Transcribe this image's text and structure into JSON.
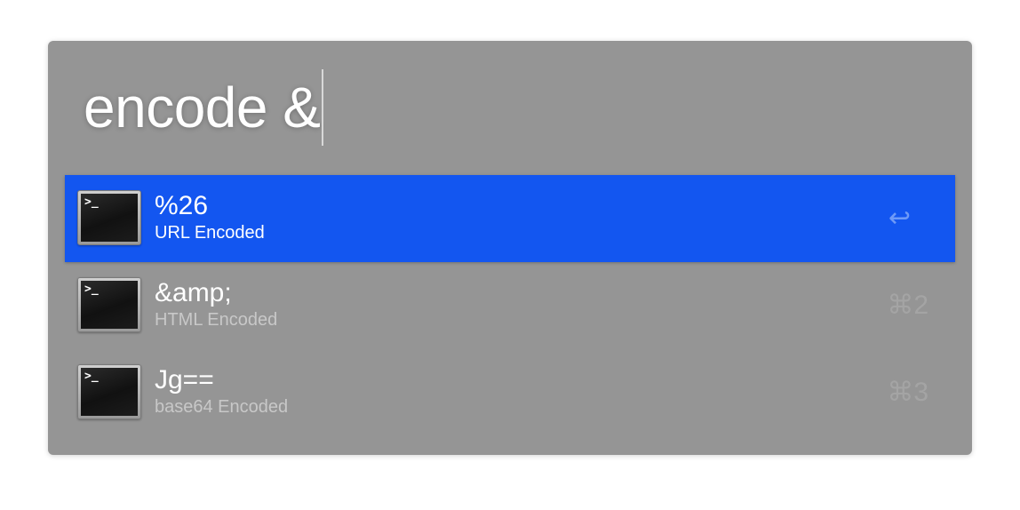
{
  "query": {
    "text": "encode &"
  },
  "results": [
    {
      "title": "%26",
      "subtitle": "URL Encoded",
      "shortcut": "↩",
      "icon": "terminal-icon",
      "selected": true
    },
    {
      "title": "&amp;",
      "subtitle": "HTML Encoded",
      "shortcut": "⌘2",
      "icon": "terminal-icon",
      "selected": false
    },
    {
      "title": "Jg==",
      "subtitle": "base64 Encoded",
      "shortcut": "⌘3",
      "icon": "terminal-icon",
      "selected": false
    }
  ],
  "terminal_prompt": ">_",
  "colors": {
    "panel_bg": "#959595",
    "selection": "#1356f0",
    "text": "#ffffff"
  }
}
